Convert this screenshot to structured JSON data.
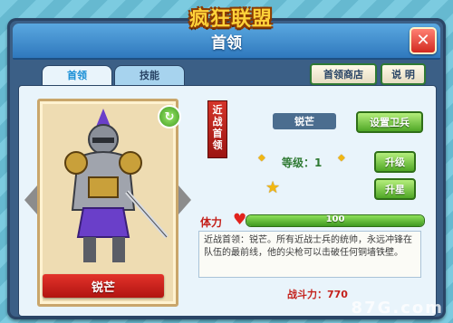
{
  "logo": {
    "text": "疯狂联盟"
  },
  "window": {
    "title": "首领"
  },
  "tabs": [
    {
      "label": "首领",
      "active": true
    },
    {
      "label": "技能",
      "active": false
    }
  ],
  "toolbar": {
    "shop_label": "首领商店",
    "help_label": "说 明"
  },
  "hero": {
    "name": "锐芒",
    "class_label": "近战首领",
    "name_box": "锐芒",
    "level_text": "等级：1",
    "stars": 1,
    "hp_label": "体力",
    "hp_value": "100",
    "hp_fraction": 1.0,
    "description": "近战首领：锐芒。所有近战士兵的统帅，永远冲锋在队伍的最前线，他的尖枪可以击破任何铜墙铁壁。",
    "power_text": "战斗力：770"
  },
  "buttons": {
    "set_guard": "设置卫兵",
    "upgrade": "升级",
    "star_up": "升星"
  },
  "watermark": {
    "text": "87G.com"
  },
  "colors": {
    "accent": "#2f78bd",
    "green_button": "#4fa726",
    "red_ribbon": "#b11410",
    "hp_bar": "#3f9a21"
  }
}
